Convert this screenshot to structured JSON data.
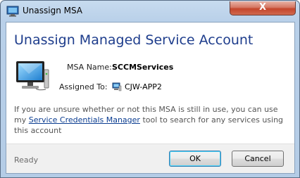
{
  "window": {
    "title": "Unassign MSA",
    "close_glyph": "X",
    "icon": "dialog-app-icon"
  },
  "heading": "Unassign Managed Service Account",
  "fields": {
    "msa_name_label": "MSA Name:",
    "msa_name_value": "SCCMServices",
    "assigned_to_label": "Assigned To:",
    "assigned_to_value": "CJW-APP2"
  },
  "info": {
    "text_before": "If you are unsure whether or not this MSA is still in use, you can use my ",
    "link": "Service Credentials Manager",
    "text_after": " tool to search for any services using this account"
  },
  "footer": {
    "status": "Ready",
    "ok_label": "OK",
    "cancel_label": "Cancel"
  },
  "colors": {
    "heading": "#1e3d8c",
    "link": "#0b3d91",
    "close_button": "#c4452c"
  }
}
